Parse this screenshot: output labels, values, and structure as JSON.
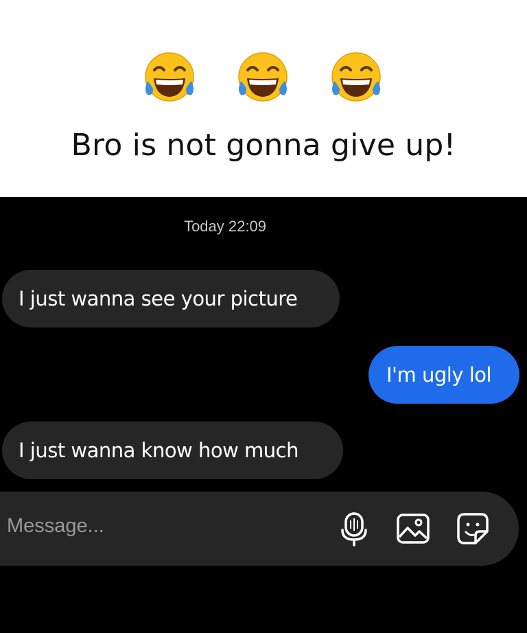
{
  "meme": {
    "emojis": [
      "face-with-tears-of-joy",
      "face-with-tears-of-joy",
      "face-with-tears-of-joy"
    ],
    "caption": "Bro is not gonna give up!"
  },
  "chat": {
    "timestamp": "Today 22:09",
    "messages": [
      {
        "direction": "incoming",
        "text": "I just wanna see your picture"
      },
      {
        "direction": "outgoing",
        "text": "I'm ugly lol"
      },
      {
        "direction": "incoming",
        "text": "I just wanna know how much"
      }
    ],
    "composer": {
      "placeholder": "Message...",
      "icons": [
        "microphone-icon",
        "image-icon",
        "sticker-icon"
      ]
    }
  },
  "colors": {
    "background_top": "#ffffff",
    "chat_background": "#000000",
    "incoming_bubble": "#262626",
    "outgoing_bubble": "#1f6bea",
    "text": "#ffffff"
  }
}
